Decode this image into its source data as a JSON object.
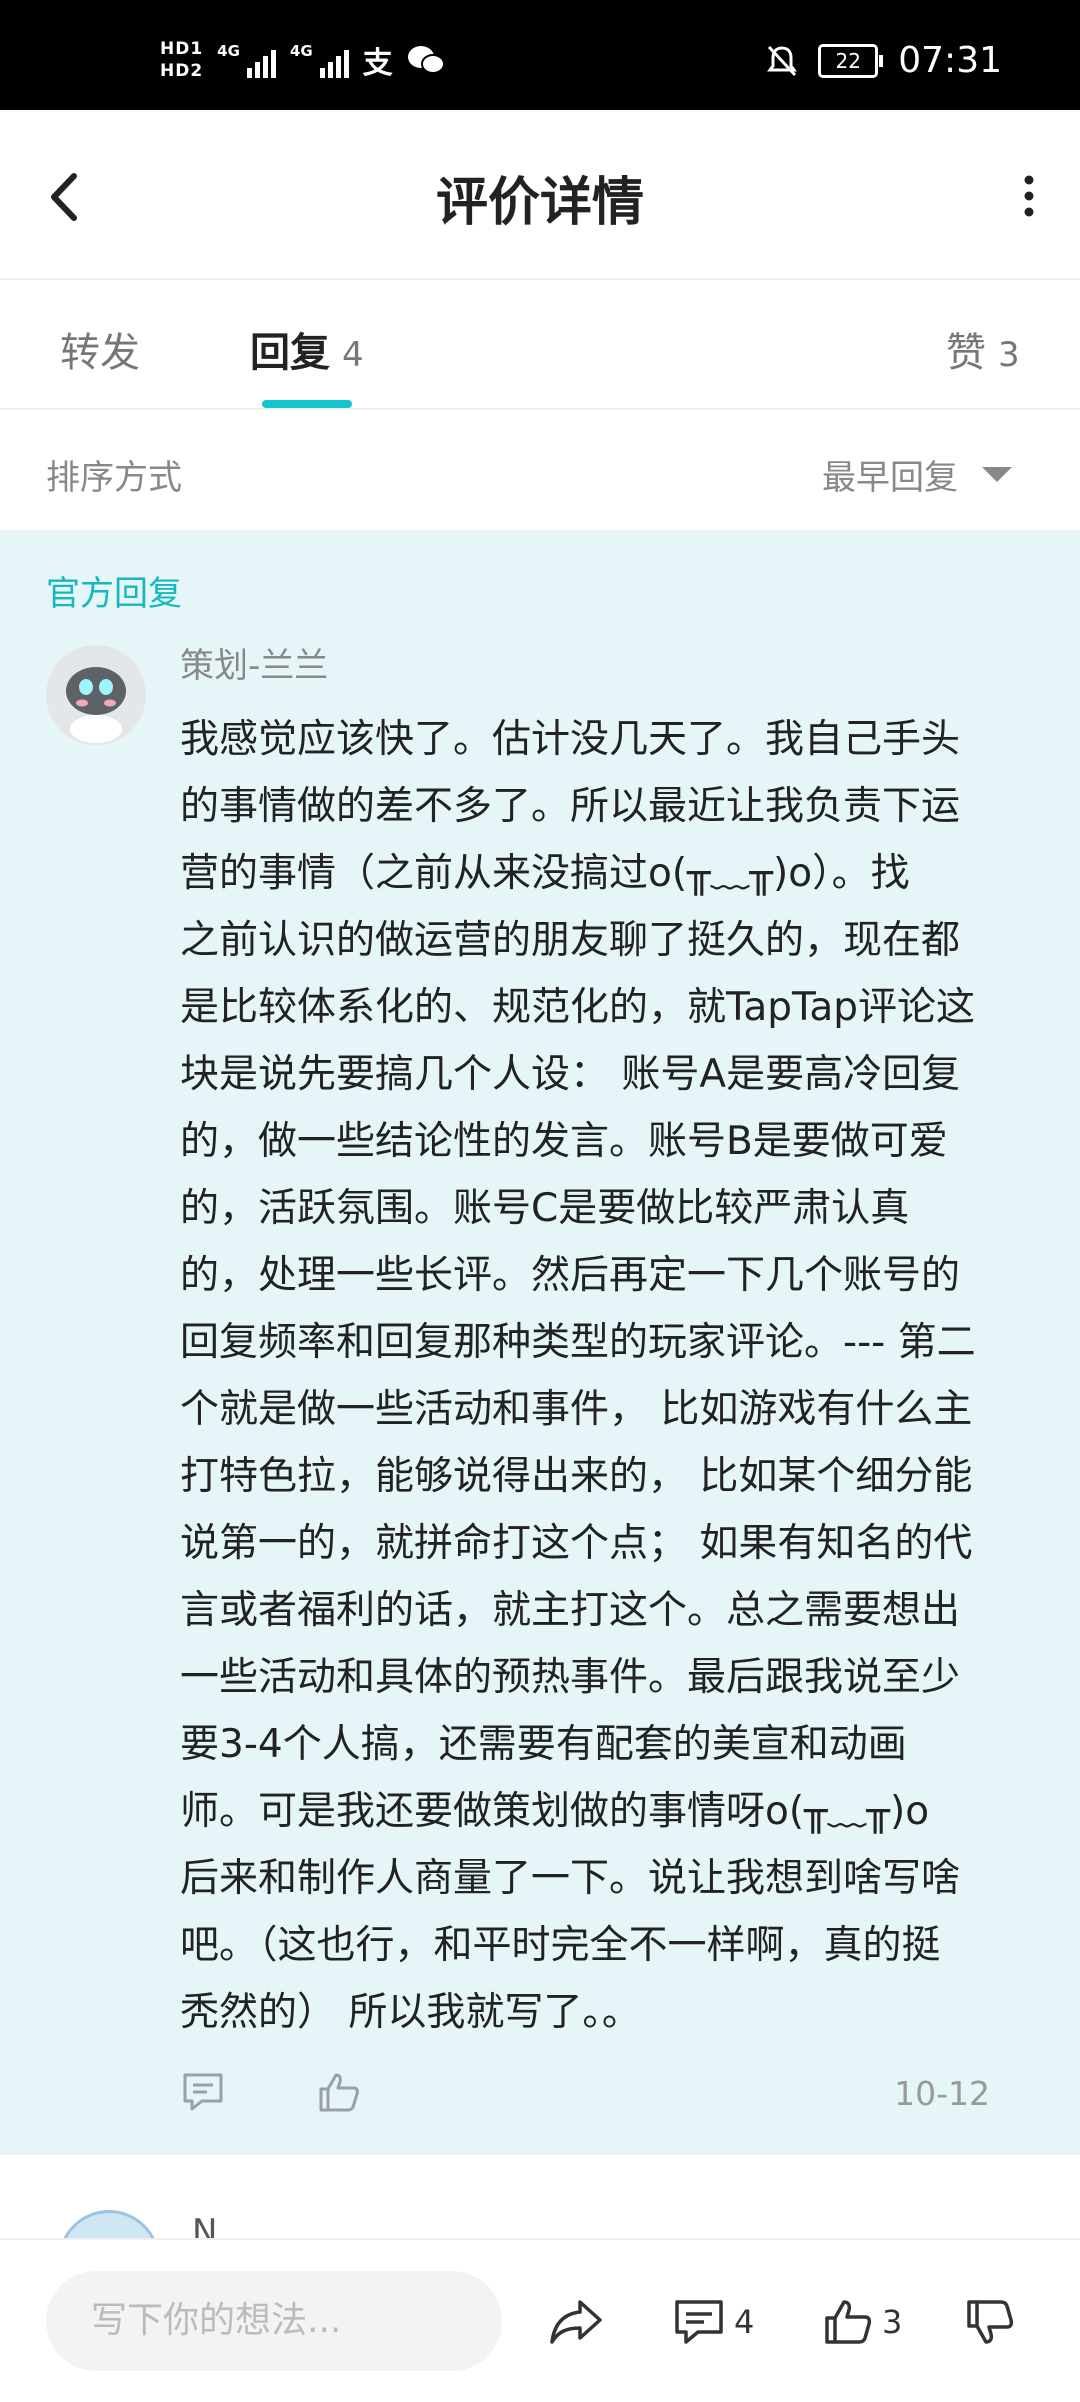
{
  "status_bar": {
    "hd1": "HD1",
    "hd2": "HD2",
    "net1": "4G",
    "net2": "4G",
    "battery": "22",
    "time": "07:31"
  },
  "header": {
    "title": "评价详情"
  },
  "tabs": [
    {
      "label": "转发",
      "count": ""
    },
    {
      "label": "回复",
      "count": "4"
    },
    {
      "label": "赞",
      "count": "3"
    }
  ],
  "sort": {
    "label": "排序方式",
    "value": "最早回复"
  },
  "reply": {
    "badge": "官方回复",
    "author": "策划-兰兰",
    "content_lines": [
      "我感觉应该快了。估计没几天了。我自己手头",
      "的事情做的差不多了。所以最近让我负责下运",
      "营的事情（之前从来没搞过o(╥﹏╥)o）。找",
      "之前认识的做运营的朋友聊了挺久的，现在都",
      "是比较体系化的、规范化的，就TapTap评论这",
      "块是说先要搞几个人设： 账号A是要高冷回复",
      "的，做一些结论性的发言。账号B是要做可爱",
      "的，活跃氛围。账号C是要做比较严肃认真",
      "的，处理一些长评。然后再定一下几个账号的",
      "回复频率和回复那种类型的玩家评论。--- 第二",
      "个就是做一些活动和事件， 比如游戏有什么主",
      "打特色拉，能够说得出来的， 比如某个细分能",
      "说第一的，就拼命打这个点； 如果有知名的代",
      "言或者福利的话，就主打这个。总之需要想出",
      "一些活动和具体的预热事件。最后跟我说至少",
      "要3-4个人搞，还需要有配套的美宣和动画",
      "师。可是我还要做策划做的事情呀o(╥﹏╥)o",
      "后来和制作人商量了一下。说让我想到啥写啥",
      "吧。（这也行，和平时完全不一样啊，真的挺",
      "秃然的） 所以我就写了。。"
    ],
    "date": "10-12"
  },
  "next_reply": {
    "author": "N"
  },
  "bottom_bar": {
    "input_placeholder": "写下你的想法...",
    "comment_count": "4",
    "like_count": "3"
  },
  "colors": {
    "accent": "#15c5ce",
    "reply_bg": "#e6f6f8",
    "official_text": "#15b8c0"
  },
  "icons": [
    "back-arrow-icon",
    "more-vertical-icon",
    "caret-down-icon",
    "comment-icon",
    "thumbs-up-icon",
    "share-icon",
    "thumbs-down-icon",
    "mute-icon",
    "wechat-icon",
    "alipay-icon"
  ]
}
